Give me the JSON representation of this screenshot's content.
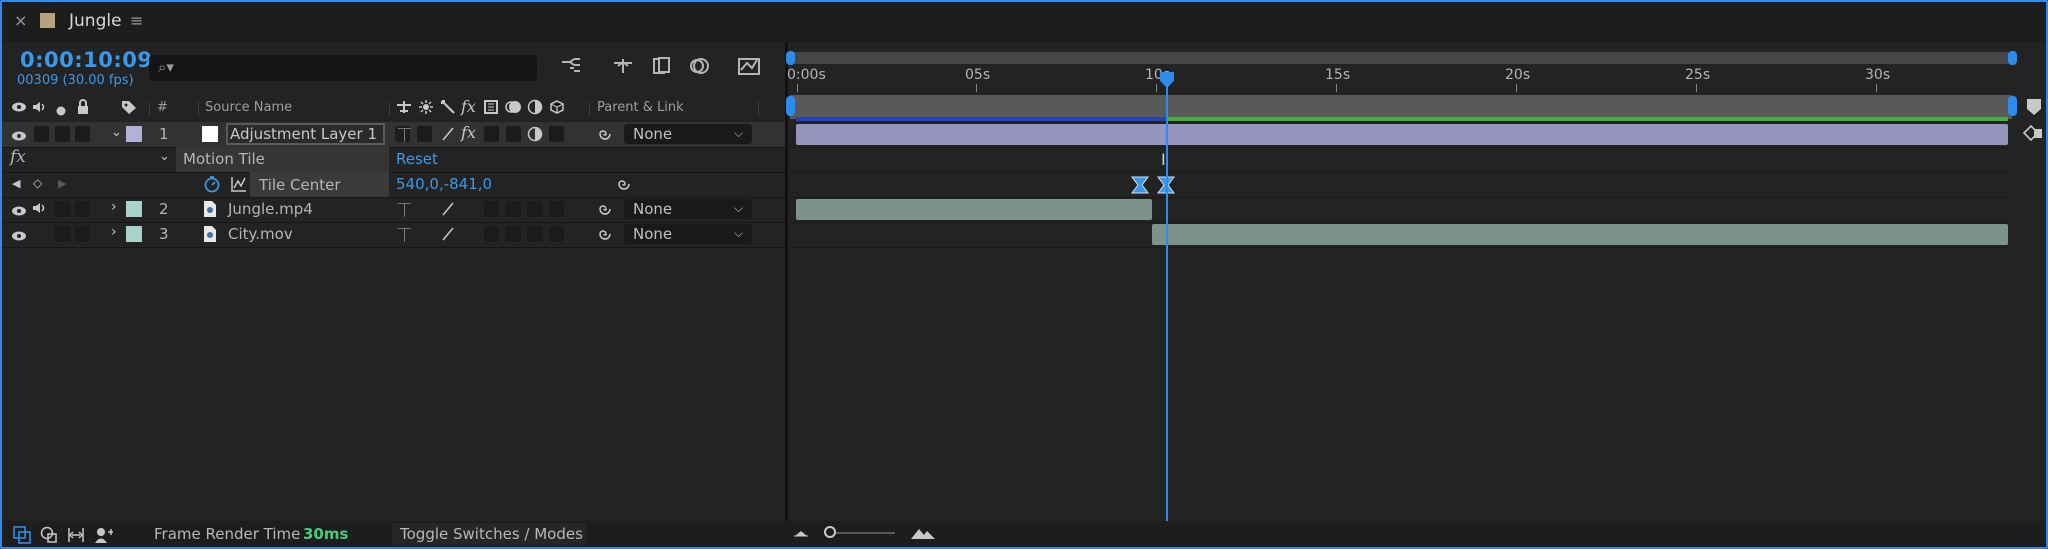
{
  "tab": {
    "title": "Jungle",
    "close_glyph": "×",
    "menu_glyph": "≡"
  },
  "header": {
    "timecode": "0:00:10:09",
    "frames": "00309 (30.00 fps)",
    "search_placeholder": ""
  },
  "columns": {
    "number": "#",
    "source_name": "Source Name",
    "parent_link": "Parent & Link"
  },
  "layers": [
    {
      "index": "1",
      "name": "Adjustment Layer 1",
      "color": "#b3b1d6",
      "parent": "None"
    },
    {
      "index": "2",
      "name": "Jungle.mp4",
      "color": "#a9d2c8",
      "parent": "None"
    },
    {
      "index": "3",
      "name": "City.mov",
      "color": "#a9d2c8",
      "parent": "None"
    }
  ],
  "effect": {
    "fx_label": "fx",
    "name": "Motion Tile",
    "reset_label": "Reset"
  },
  "property": {
    "name": "Tile Center",
    "value": "540,0,-841,0"
  },
  "ruler": {
    "labels": [
      "0:00s",
      "05s",
      "10s",
      "15s",
      "20s",
      "25s",
      "30s"
    ]
  },
  "playhead_time": "10:09",
  "bottom": {
    "frame_render_label": "Frame Render Time",
    "frame_render_value": "30ms",
    "toggle_label": "Toggle Switches / Modes"
  },
  "colors": {
    "accent": "#2d8ceb",
    "adjustment_bar": "#9594bf",
    "clip_bar": "#7c938d",
    "render_green": "#3db23d",
    "render_blue": "#2143b8"
  }
}
